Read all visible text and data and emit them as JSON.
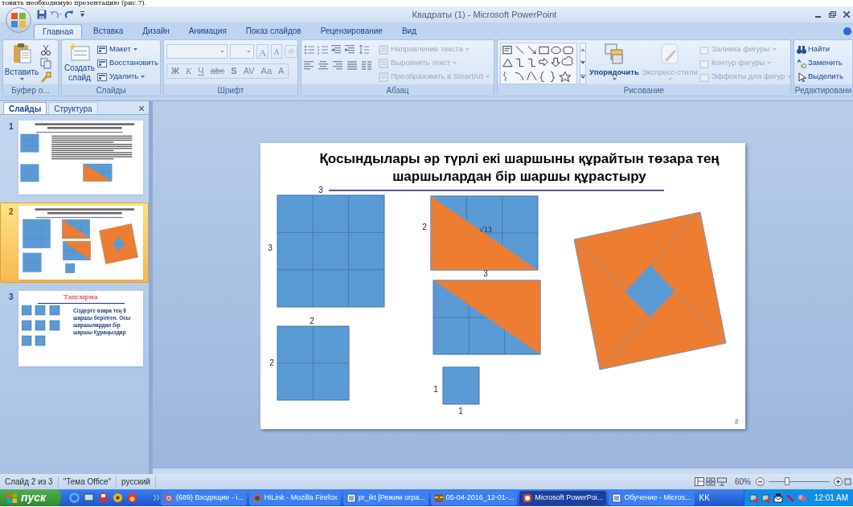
{
  "document_fragment": "товить необходимую презентацию (рис.7).",
  "window": {
    "title": "Квадраты (1) - Microsoft PowerPoint"
  },
  "tabs": [
    {
      "label": "Главная",
      "selected": true
    },
    {
      "label": "Вставка",
      "selected": false
    },
    {
      "label": "Дизайн",
      "selected": false
    },
    {
      "label": "Анимация",
      "selected": false
    },
    {
      "label": "Показ слайдов",
      "selected": false
    },
    {
      "label": "Рецензирование",
      "selected": false
    },
    {
      "label": "Вид",
      "selected": false
    }
  ],
  "ribbon": {
    "clipboard": {
      "label": "Буфер о...",
      "paste": "Вставить"
    },
    "slides": {
      "label": "Слайды",
      "new_slide": "Создать слайд",
      "commands": [
        {
          "label": "Макет",
          "disabled": false
        },
        {
          "label": "Восстановить",
          "disabled": false
        },
        {
          "label": "Удалить",
          "disabled": false
        }
      ]
    },
    "font": {
      "label": "Шрифт",
      "size_buttons": [
        {
          "label": "A",
          "kind": "grow"
        },
        {
          "label": "A",
          "kind": "shrink"
        }
      ],
      "format_buttons": [
        {
          "label": "Ж",
          "kind": "bold"
        },
        {
          "label": "К",
          "kind": "italic"
        },
        {
          "label": "Ч",
          "kind": "underline"
        },
        {
          "label": "abc",
          "kind": "strike"
        },
        {
          "label": "S",
          "kind": "shadow"
        },
        {
          "label": "AV",
          "kind": "spacing"
        },
        {
          "label": "Aa",
          "kind": "case"
        },
        {
          "label": "A",
          "kind": "color"
        }
      ]
    },
    "paragraph": {
      "label": "Абзац",
      "commands": [
        {
          "label": "Направление текста",
          "disabled": true
        },
        {
          "label": "Выровнять текст",
          "disabled": true
        },
        {
          "label": "Преобразовать в SmartArt",
          "disabled": true
        }
      ]
    },
    "drawing": {
      "label": "Рисование",
      "arrange": "Упорядочить",
      "quick_styles": {
        "label": "Экспресс-стили",
        "disabled": true
      },
      "commands": [
        {
          "label": "Заливка фигуры",
          "disabled": true
        },
        {
          "label": "Контур фигуры",
          "disabled": true
        },
        {
          "label": "Эффекты для фигур",
          "disabled": true
        }
      ]
    },
    "editing": {
      "label": "Редактировани",
      "commands": [
        {
          "label": "Найти"
        },
        {
          "label": "Заменить"
        },
        {
          "label": "Выделить"
        }
      ]
    }
  },
  "slides_panel": {
    "tabs": [
      {
        "label": "Слайды",
        "selected": true
      },
      {
        "label": "Структура",
        "selected": false
      }
    ],
    "slides": [
      {
        "number": "1",
        "kind": "squares_text",
        "selected": false
      },
      {
        "number": "2",
        "kind": "squares_pinwheel",
        "selected": true
      },
      {
        "number": "3",
        "kind": "task",
        "selected": false,
        "title": "Тапсырма",
        "text": "Сіздерге өзара тең 8 шаршы берілген. Осы шаршылардан бір шаршы Құраңыздар"
      }
    ]
  },
  "slide": {
    "title": "Қосындылары әр түрлі екі шаршыны құрайтын төзара тең шаршылардан бір шаршы құрастыру",
    "labels": [
      "3",
      "3",
      "2",
      "2",
      "2",
      "3",
      "√13",
      "1",
      "1"
    ],
    "number": "2"
  },
  "status_bar": {
    "items": [
      "Слайд 2 из 3",
      "\"Тема Office\"",
      "русский"
    ],
    "zoom": "60%",
    "zoom_slider": {
      "level": 0.3
    }
  },
  "taskbar": {
    "start": "пуск",
    "tasks": [
      {
        "label": "(689) Входящие - i...",
        "selected": false
      },
      {
        "label": "HiLink - Mozilla Firefox",
        "selected": false
      },
      {
        "label": "pr_ikt [Режим огра...",
        "selected": false
      },
      {
        "label": "05-04-2016_12-01-...",
        "selected": false
      },
      {
        "label": "Microsoft PowerPoi...",
        "selected": true
      },
      {
        "label": "Обучение - Micros...",
        "selected": false
      }
    ],
    "language": "KK",
    "time": "12:01 AM"
  }
}
